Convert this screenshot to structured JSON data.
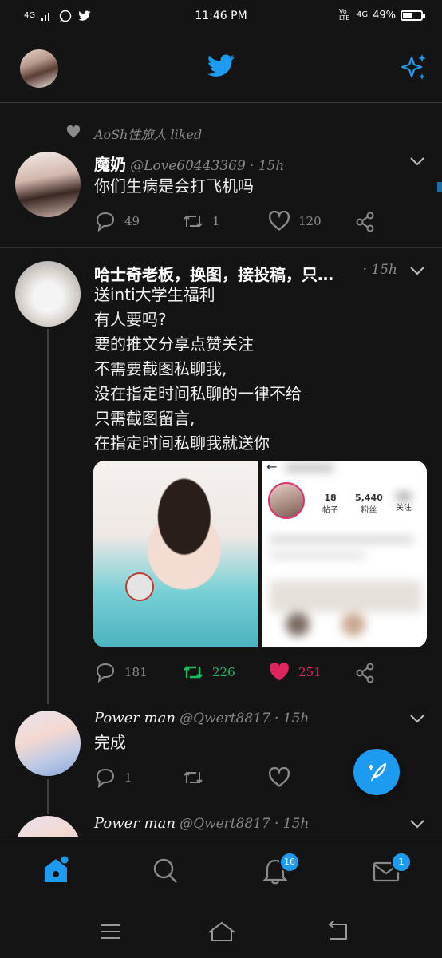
{
  "statusbar": {
    "network_left": "4G",
    "time": "11:46 PM",
    "volte": "Vo LTE",
    "network_right": "4G",
    "battery": "49%",
    "battery_level": 0.49
  },
  "liked_banner": {
    "text": "AoSh性旅人 liked"
  },
  "tweets": [
    {
      "name": "魔奶",
      "handle": "@Love60443369",
      "time": "· 15h",
      "text": "你们生病是会打飞机吗",
      "reply_count": "49",
      "retweet_count": "1",
      "like_count": "120"
    },
    {
      "name": "哈士奇老板，换图，接投稿，只…",
      "time": "· 15h",
      "lines": [
        "送inti大学生福利",
        "有人要吗?",
        "要的推文分享点赞关注",
        "不需要截图私聊我,",
        "没在指定时间私聊的一律不给",
        "只需截图留言,",
        "在指定时间私聊我就送你"
      ],
      "reply_count": "181",
      "retweet_count": "226",
      "like_count": "251",
      "retweet_color": "#17bf63",
      "like_color": "#e0245e",
      "profile_card": {
        "back_arrow": "←",
        "posts_value": "18",
        "posts_label": "帖子",
        "fans_value": "5,440",
        "fans_label": "粉丝",
        "follow_label": "关注"
      }
    },
    {
      "name": "Power man",
      "handle": "@Qwert8817",
      "time": "· 15h",
      "text": "完成",
      "reply_count": "1"
    },
    {
      "name": "Power man",
      "handle": "@Qwert8817",
      "time": "· 15h"
    }
  ],
  "bottomnav": {
    "notifications_badge": "16",
    "messages_badge": "1"
  },
  "colors": {
    "accent": "#1d9bf0",
    "background": "#141414"
  }
}
